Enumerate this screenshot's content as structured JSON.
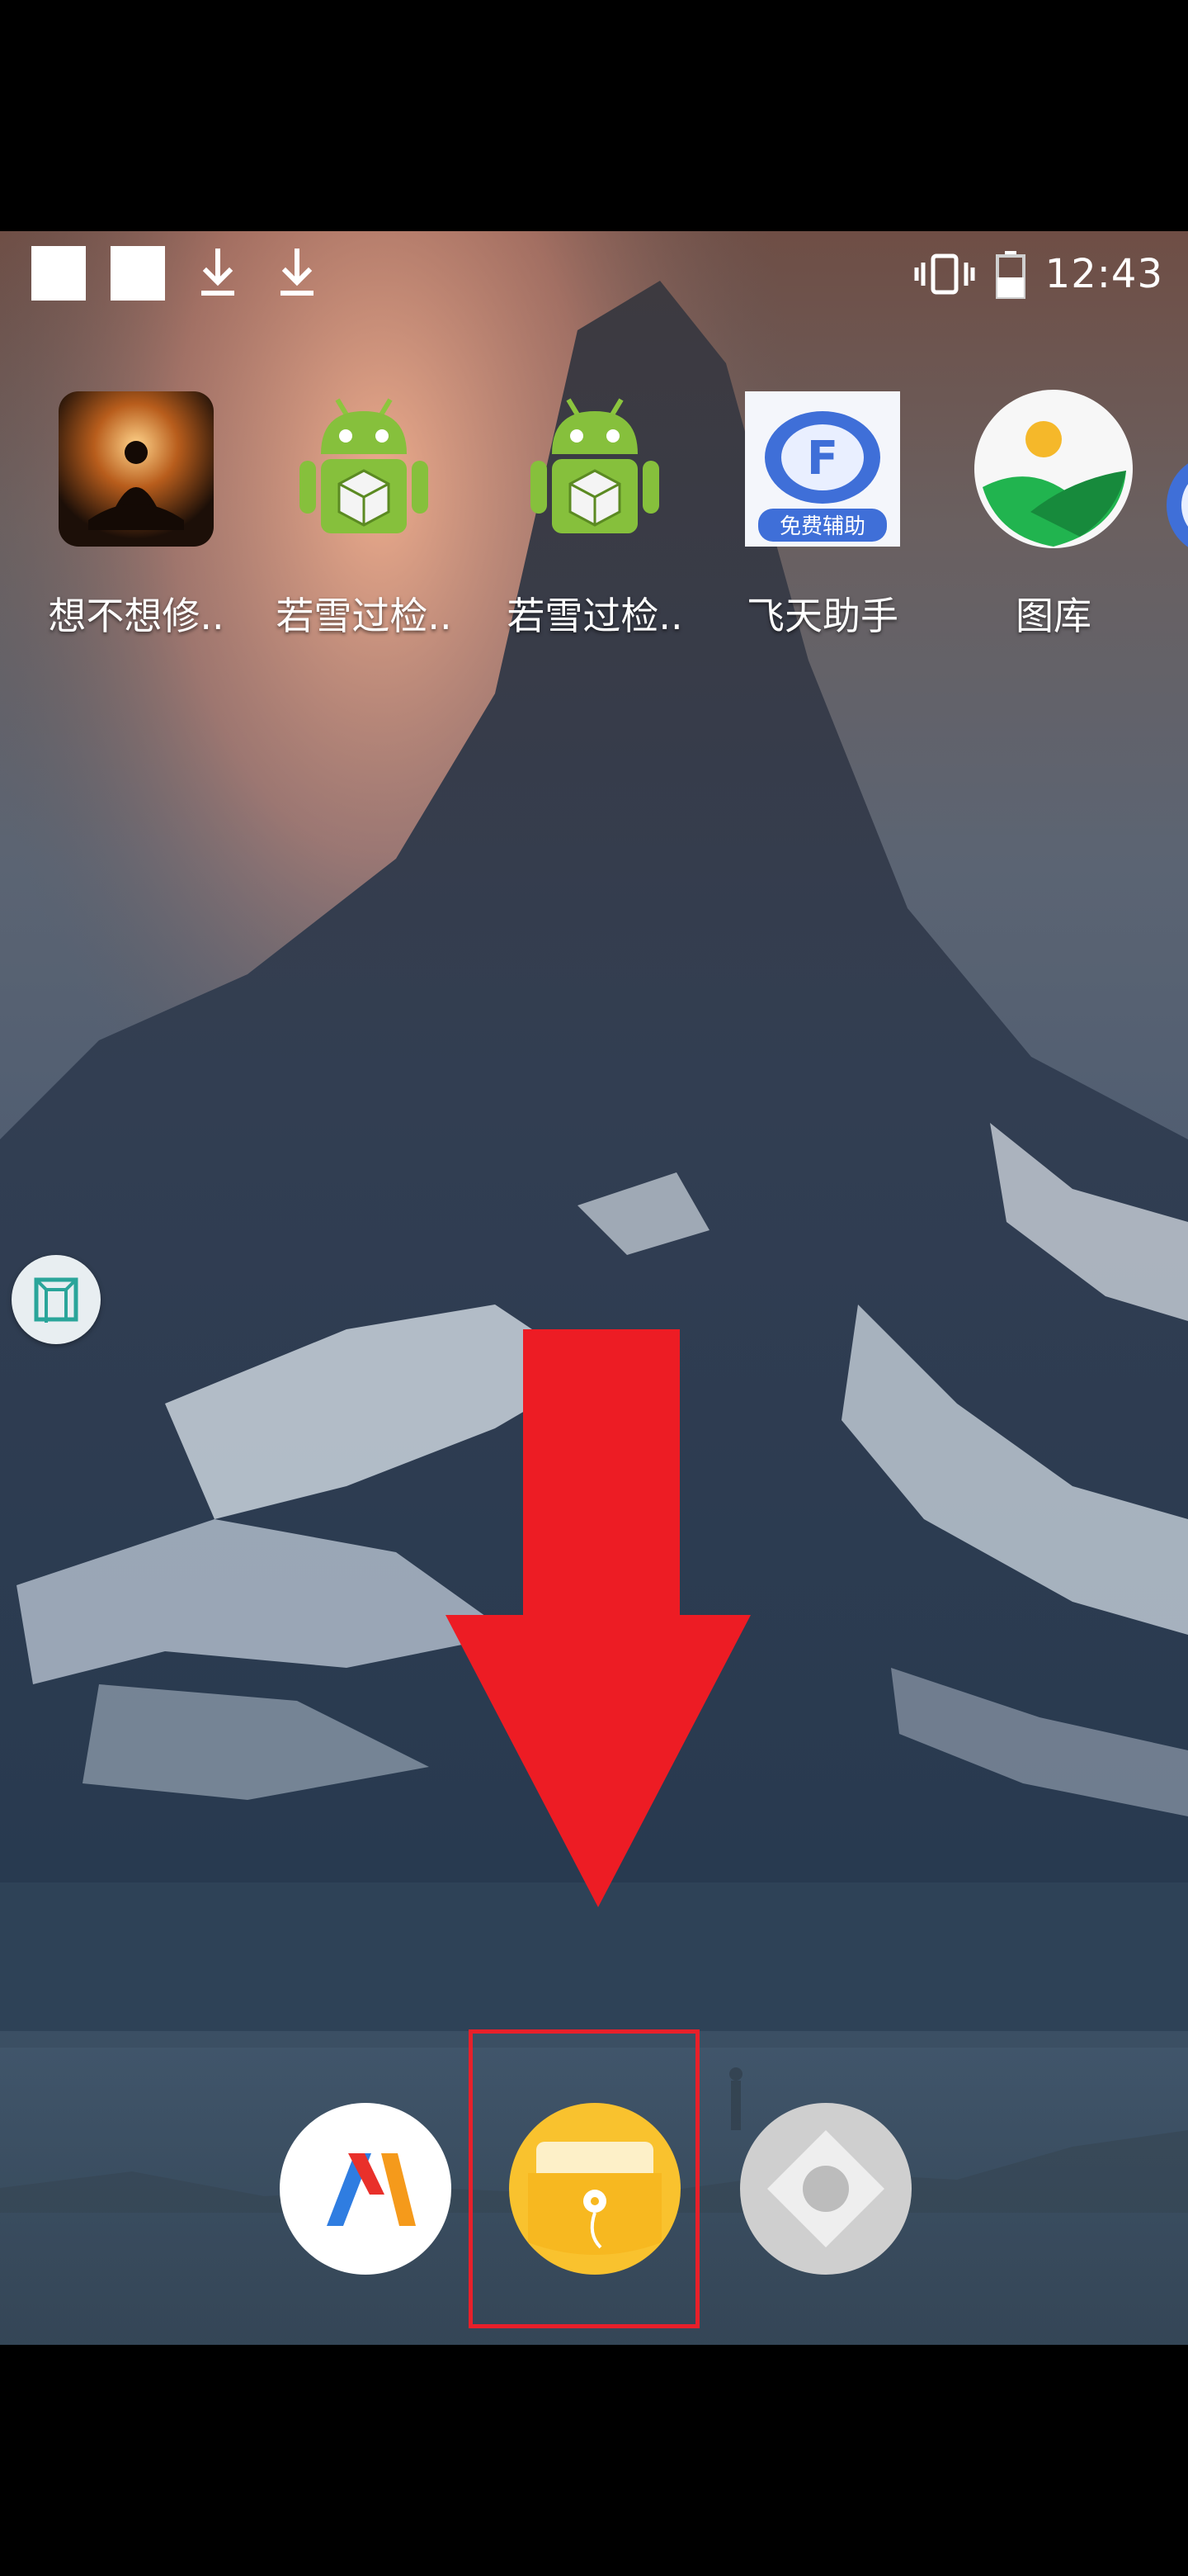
{
  "status_bar": {
    "time": "12:43",
    "icons": [
      "notification-square-icon",
      "notification-square-icon",
      "download-icon",
      "download-icon",
      "vibrate-icon",
      "battery-icon"
    ]
  },
  "home_apps": [
    {
      "label": "想不想修..",
      "icon": "meditation-game-icon"
    },
    {
      "label": "若雪过检..",
      "icon": "android-robot-icon"
    },
    {
      "label": "若雪过检..",
      "icon": "android-robot-icon"
    },
    {
      "label": "飞天助手",
      "icon": "feitian-assistant-icon",
      "badge_text": "免费辅助"
    },
    {
      "label": "图库",
      "icon": "gallery-icon"
    }
  ],
  "dock_apps": [
    {
      "icon": "orange-blue-stripes-app-icon"
    },
    {
      "icon": "yellow-folder-app-icon"
    },
    {
      "icon": "gray-diamond-app-icon"
    }
  ],
  "colors": {
    "arrow": "#ED1C24",
    "highlight_border": "#E8202A",
    "dock_yellow": "#F9C22E"
  }
}
